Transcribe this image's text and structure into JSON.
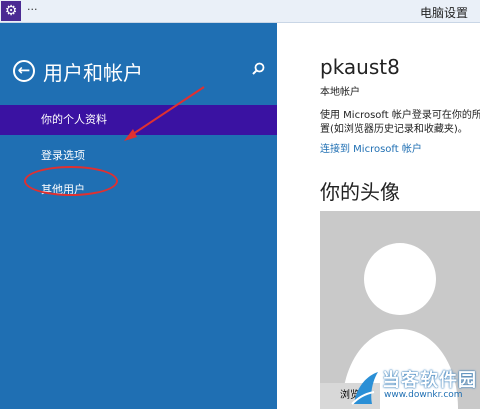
{
  "window": {
    "title_dots": "···",
    "title": "电脑设置"
  },
  "left_pane": {
    "title": "用户和帐户",
    "nav_items": [
      {
        "label": "你的个人资料",
        "active": true
      },
      {
        "label": "登录选项",
        "active": false
      },
      {
        "label": "其他用户",
        "active": false
      }
    ]
  },
  "right_pane": {
    "user_name": "pkaust8",
    "account_type": "本地帐户",
    "description_line1": "使用 Microsoft 帐户登录可在你的所",
    "description_line2": "置(如浏览器历史记录和收藏夹)。",
    "link_label": "连接到 Microsoft 帐户",
    "avatar_heading": "你的头像",
    "browse_label": "浏览"
  },
  "watermark": {
    "text": "当客软件园",
    "url": "www.downkr.com"
  },
  "colors": {
    "left_bg": "#1f6fb3",
    "active_item": "#3a12a2",
    "annotation": "#e03030",
    "link": "#1f6fb3"
  }
}
